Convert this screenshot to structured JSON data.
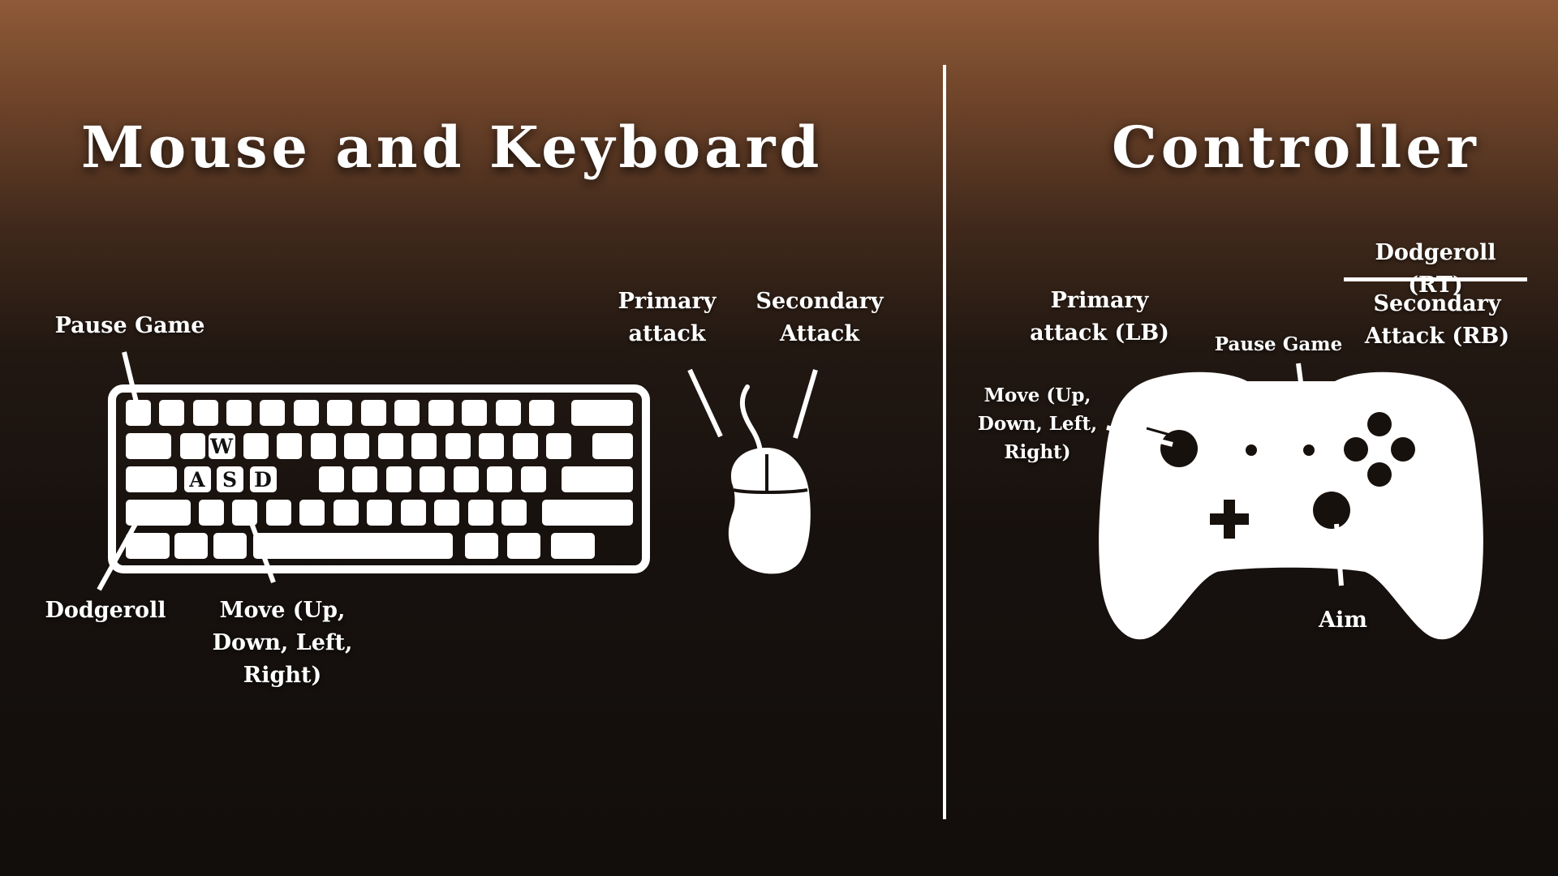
{
  "colors": {
    "foreground": "#ffffff",
    "background_top": "#8f5a38",
    "background_bottom": "#120e0c"
  },
  "keyboard_section": {
    "title": "Mouse and Keyboard",
    "keys": {
      "w": "W",
      "a": "A",
      "s": "S",
      "d": "D"
    },
    "labels": {
      "pause": "Pause Game",
      "primary": "Primary\nattack",
      "secondary": "Secondary\nAttack",
      "dodge": "Dodgeroll",
      "move": "Move (Up,\nDown, Left,\nRight)"
    }
  },
  "controller_section": {
    "title": "Controller",
    "labels": {
      "dodge": "Dodgeroll (RT)",
      "primary": "Primary\nattack (LB)",
      "pause": "Pause Game",
      "secondary": "Secondary\nAttack (RB)",
      "move": "Move (Up,\nDown, Left,\nRight)",
      "aim": "Aim"
    }
  },
  "icons": [
    "keyboard-icon",
    "mouse-icon",
    "gamepad-icon"
  ]
}
